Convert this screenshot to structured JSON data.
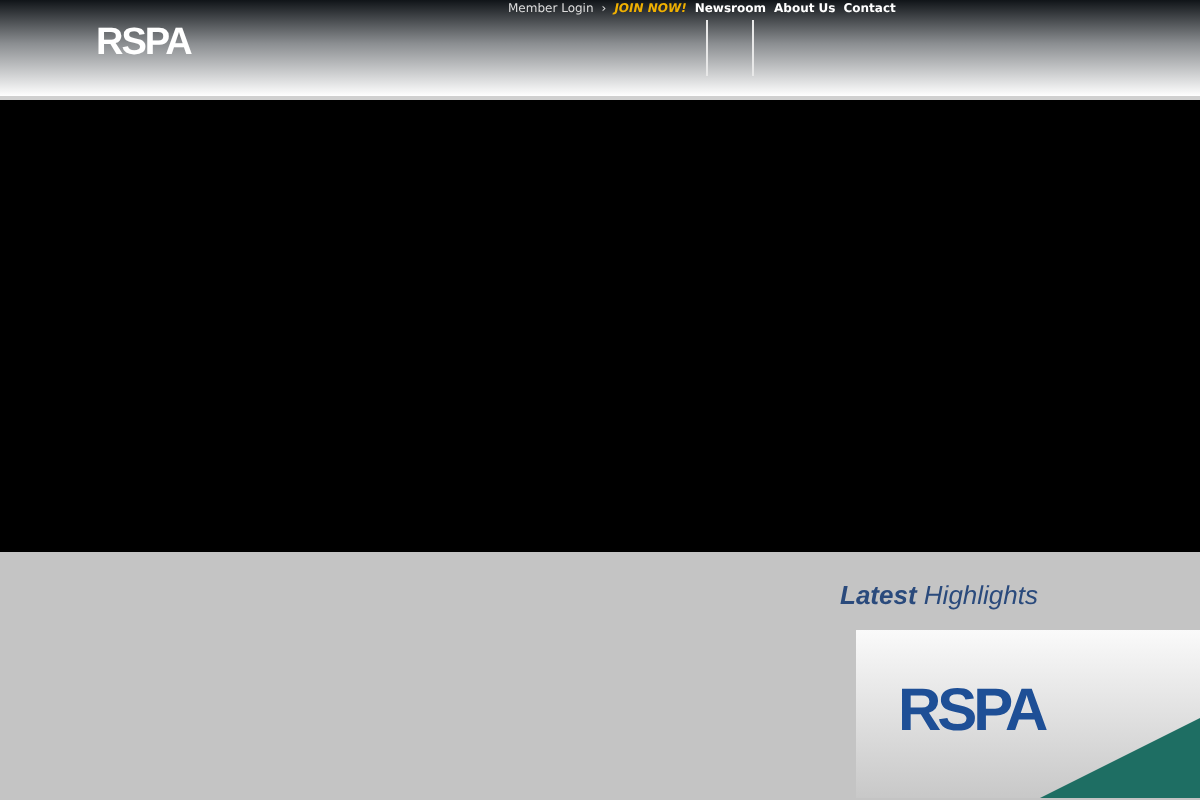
{
  "header": {
    "logo": "RSPA",
    "nav": [
      {
        "label": "Member Login",
        "kind": "plain"
      },
      {
        "label": "›",
        "kind": "plain"
      },
      {
        "label": "JOIN NOW!",
        "kind": "accent"
      },
      {
        "label": "Newsroom",
        "kind": "bold"
      },
      {
        "label": "About Us",
        "kind": "bold"
      },
      {
        "label": "Contact",
        "kind": "bold"
      }
    ]
  },
  "highlights": {
    "title_bold": "Latest",
    "title_rest": "Highlights",
    "card_logo": "RSPA"
  }
}
